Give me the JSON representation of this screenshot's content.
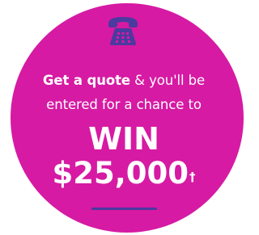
{
  "promo": {
    "icon": "telephone-icon",
    "line1_bold": "Get a quote",
    "line1_rest": " & you'll be",
    "line2": "entered for a chance to",
    "win": "WIN",
    "amount": "$25,000",
    "amount_mark": "†"
  },
  "colors": {
    "circle": "#d61aa3",
    "accent": "#4b3aa0",
    "text": "#ffffff"
  }
}
